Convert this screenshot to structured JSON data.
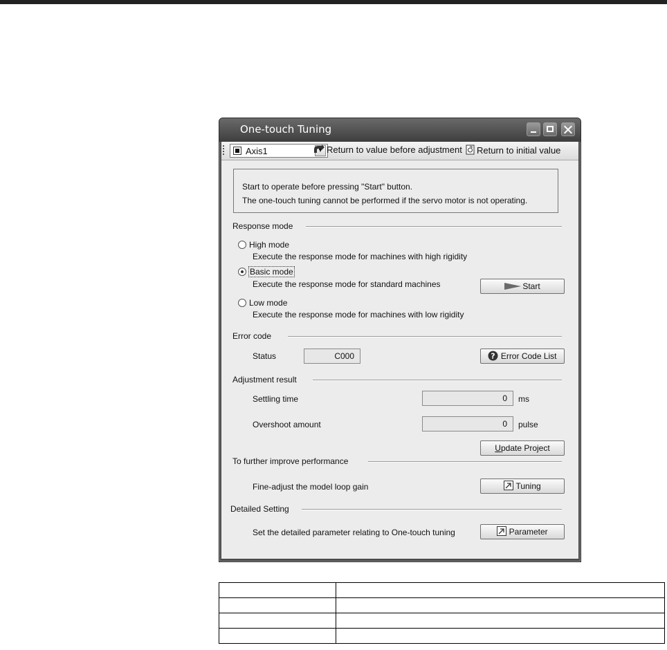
{
  "window": {
    "title": "One-touch Tuning"
  },
  "toolbar": {
    "axis_value": "Axis1",
    "return_before_label": "Return to value before adjustment",
    "return_initial_label": "Return to initial value"
  },
  "info": {
    "line1": "Start to operate before pressing \"Start\" button.",
    "line2": "The one-touch tuning cannot be performed if the servo motor is not operating."
  },
  "response_mode": {
    "heading": "Response mode",
    "selected": "Basic mode",
    "options": [
      {
        "label": "High mode",
        "description": "Execute the response mode for machines with high rigidity"
      },
      {
        "label": "Basic mode",
        "description": "Execute the response mode for standard machines"
      },
      {
        "label": "Low mode",
        "description": "Execute the response mode for machines with low rigidity"
      }
    ],
    "start_label": "Start"
  },
  "error_code": {
    "heading": "Error code",
    "status_label": "Status",
    "status_value": "C000",
    "list_button": "Error Code List"
  },
  "adjustment": {
    "heading": "Adjustment result",
    "settling_label": "Settling time",
    "settling_value": "0",
    "settling_unit": "ms",
    "overshoot_label": "Overshoot amount",
    "overshoot_value": "0",
    "overshoot_unit": "pulse",
    "update_button_prefix": "U",
    "update_button_rest": "pdate Project"
  },
  "improve": {
    "heading": "To further improve performance",
    "text": "Fine-adjust the model loop gain",
    "button": "Tuning"
  },
  "detailed": {
    "heading": "Detailed Setting",
    "text": "Set the detailed parameter relating to One-touch tuning",
    "button": "Parameter"
  },
  "colors": {
    "titlebar": "#4c4c4c",
    "panel": "#ececec"
  }
}
